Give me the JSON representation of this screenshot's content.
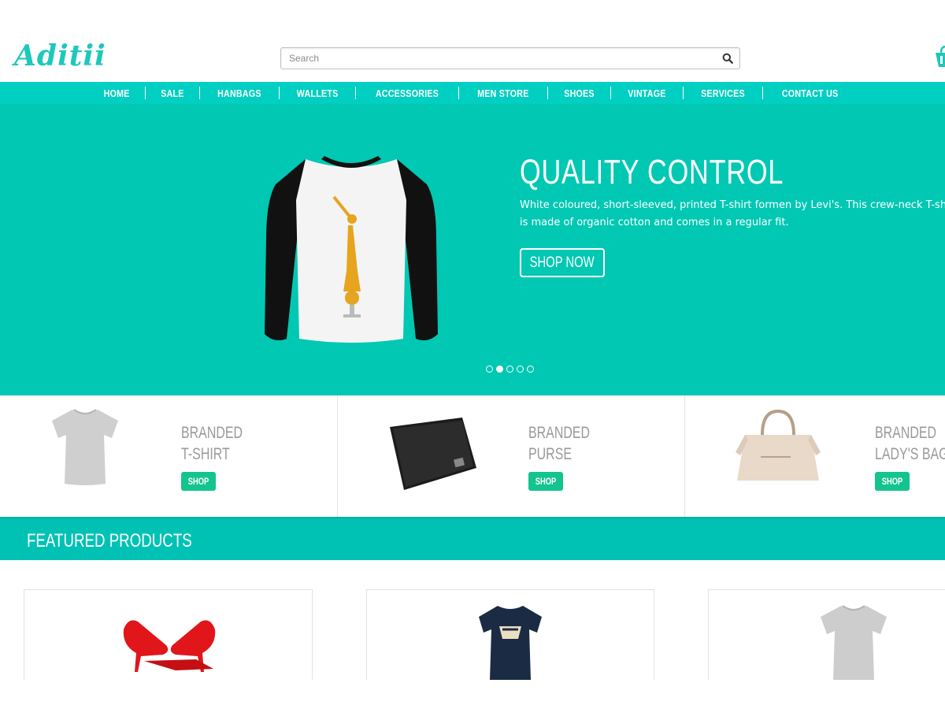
{
  "brand": {
    "logo_text": "Aditii"
  },
  "search": {
    "placeholder": "Search"
  },
  "nav": {
    "items": [
      "HOME",
      "SALE",
      "HANBAGS",
      "WALLETS",
      "ACCESSORIES",
      "MEN STORE",
      "SHOES",
      "VINTAGE",
      "SERVICES",
      "CONTACT US"
    ]
  },
  "hero": {
    "title": "QUALITY CONTROL",
    "text": "White coloured, short-sleeved, printed T-shirt formen by Levi's. This crew-neck T-shirt is made of organic cotton and comes in a regular fit.",
    "button_label": "SHOP NOW",
    "slides_total": 5,
    "active_slide": 2
  },
  "categories": [
    {
      "line1": "BRANDED",
      "line2": "T-SHIRT",
      "button": "SHOP"
    },
    {
      "line1": "BRANDED",
      "line2": "PURSE",
      "button": "SHOP"
    },
    {
      "line1": "BRANDED",
      "line2": "LADY'S BAG",
      "button": "SHOP"
    }
  ],
  "featured": {
    "title": "FEATURED PRODUCTS"
  },
  "icons": {
    "search": "search-icon",
    "cart": "cart-icon"
  },
  "colors": {
    "brand": "#1ec8bb",
    "nav": "#00cfc1",
    "hero": "#00c8b3",
    "shop_button": "#14c48f"
  }
}
